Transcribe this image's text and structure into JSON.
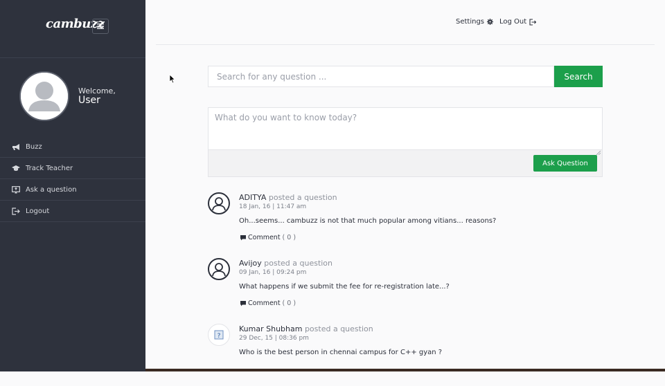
{
  "app": {
    "logo_text": "cambuzz"
  },
  "sidebar": {
    "welcome_label": "Welcome,",
    "username": "User",
    "items": [
      {
        "label": "Buzz",
        "icon": "megaphone-icon"
      },
      {
        "label": "Track Teacher",
        "icon": "graduation-cap-icon"
      },
      {
        "label": "Ask a question",
        "icon": "ask-box-icon"
      },
      {
        "label": "Logout",
        "icon": "logout-icon"
      }
    ]
  },
  "header": {
    "settings_label": "Settings",
    "logout_label": "Log Out"
  },
  "search": {
    "placeholder": "Search for any question ...",
    "button_label": "Search"
  },
  "ask": {
    "placeholder": "What do you want to know today?",
    "button_label": "Ask Question"
  },
  "posts": [
    {
      "author": "ADITYA",
      "verb": "posted a question",
      "date": "18 Jan, 16 | 11:47 am",
      "body": "Oh...seems... cambuzz is not that much popular among vitians... reasons?",
      "comment_label": "Comment",
      "comment_count": "( 0 )"
    },
    {
      "author": "Avijoy",
      "verb": "posted a question",
      "date": "09 Jan, 16 | 09:24 pm",
      "body": "What happens if we submit the fee for re-registration late...?",
      "comment_label": "Comment",
      "comment_count": "( 0 )"
    },
    {
      "author": "Kumar Shubham",
      "verb": "posted a question",
      "date": "29 Dec, 15 | 08:36 pm",
      "body": "Who is the best person in chennai campus for C++ gyan ?"
    }
  ],
  "colors": {
    "sidebar_bg": "#2e323d",
    "accent_green": "#1c9f4b",
    "page_bg": "#fafafb"
  }
}
